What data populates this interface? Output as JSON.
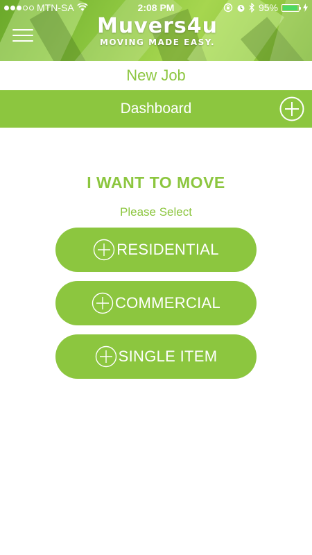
{
  "status_bar": {
    "carrier": "MTN-SA",
    "time": "2:08 PM",
    "battery_percent": "95%",
    "battery_level": 0.95,
    "signal_bars": 3
  },
  "header": {
    "logo_text": "Muvers4u",
    "logo_tagline": "MOVING MADE EASY."
  },
  "page": {
    "title": "New Job"
  },
  "dashboard_bar": {
    "title": "Dashboard"
  },
  "main": {
    "heading": "I WANT TO MOVE",
    "subheading": "Please Select",
    "options": [
      {
        "label": "RESIDENTIAL"
      },
      {
        "label": "COMMERCIAL"
      },
      {
        "label": "SINGLE ITEM"
      }
    ]
  },
  "colors": {
    "accent": "#8cc63f",
    "text_on_accent": "#ffffff",
    "background": "#ffffff"
  }
}
